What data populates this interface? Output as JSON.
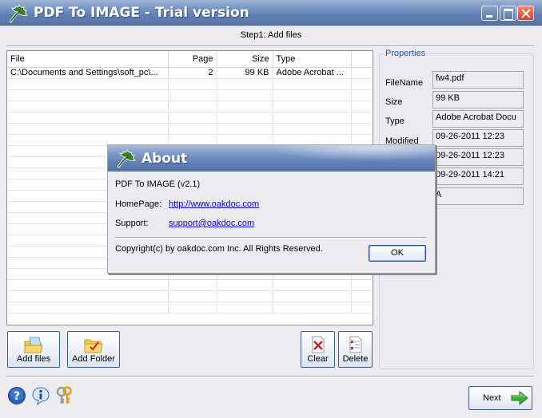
{
  "window": {
    "title": "PDF To IMAGE - Trial version",
    "controls": {
      "minimize": "minimize",
      "maximize": "maximize",
      "close": "close"
    }
  },
  "step_label": "Step1: Add files",
  "file_list": {
    "columns": [
      "File",
      "Page",
      "Size",
      "Type"
    ],
    "rows": [
      {
        "file": "C:\\Documents and Settings\\soft_pc\\...",
        "page": "2",
        "size": "99 KB",
        "type": "Adobe Acrobat ..."
      }
    ],
    "empty_rows": 21
  },
  "properties": {
    "legend": "Properties",
    "fields": [
      {
        "label": "FileName",
        "value": "fw4.pdf"
      },
      {
        "label": "Size",
        "value": "99 KB"
      },
      {
        "label": "Type",
        "value": "Adobe Acrobat Docu"
      },
      {
        "label": "Modified",
        "value": "09-26-2011 12:23"
      },
      {
        "label": "",
        "value": "09-26-2011 12:23"
      },
      {
        "label": "",
        "value": "09-29-2011 14:21"
      },
      {
        "label": "",
        "value": "A"
      }
    ]
  },
  "toolbar": {
    "add_files": "Add files",
    "add_folder": "Add Folder",
    "clear": "Clear",
    "delete": "Delete"
  },
  "footer": {
    "icons": [
      "help-icon",
      "info-icon",
      "keys-icon"
    ],
    "next": "Next"
  },
  "about_dialog": {
    "title": "About",
    "product": "PDF To IMAGE (v2.1)",
    "homepage_label": "HomePage:",
    "homepage_link": "http://www.oakdoc.com",
    "support_label": "Support:",
    "support_link": "support@oakdoc.com",
    "copyright": "Copyright(c) by oakdoc.com Inc. All Rights Reserved.",
    "ok": "OK"
  }
}
